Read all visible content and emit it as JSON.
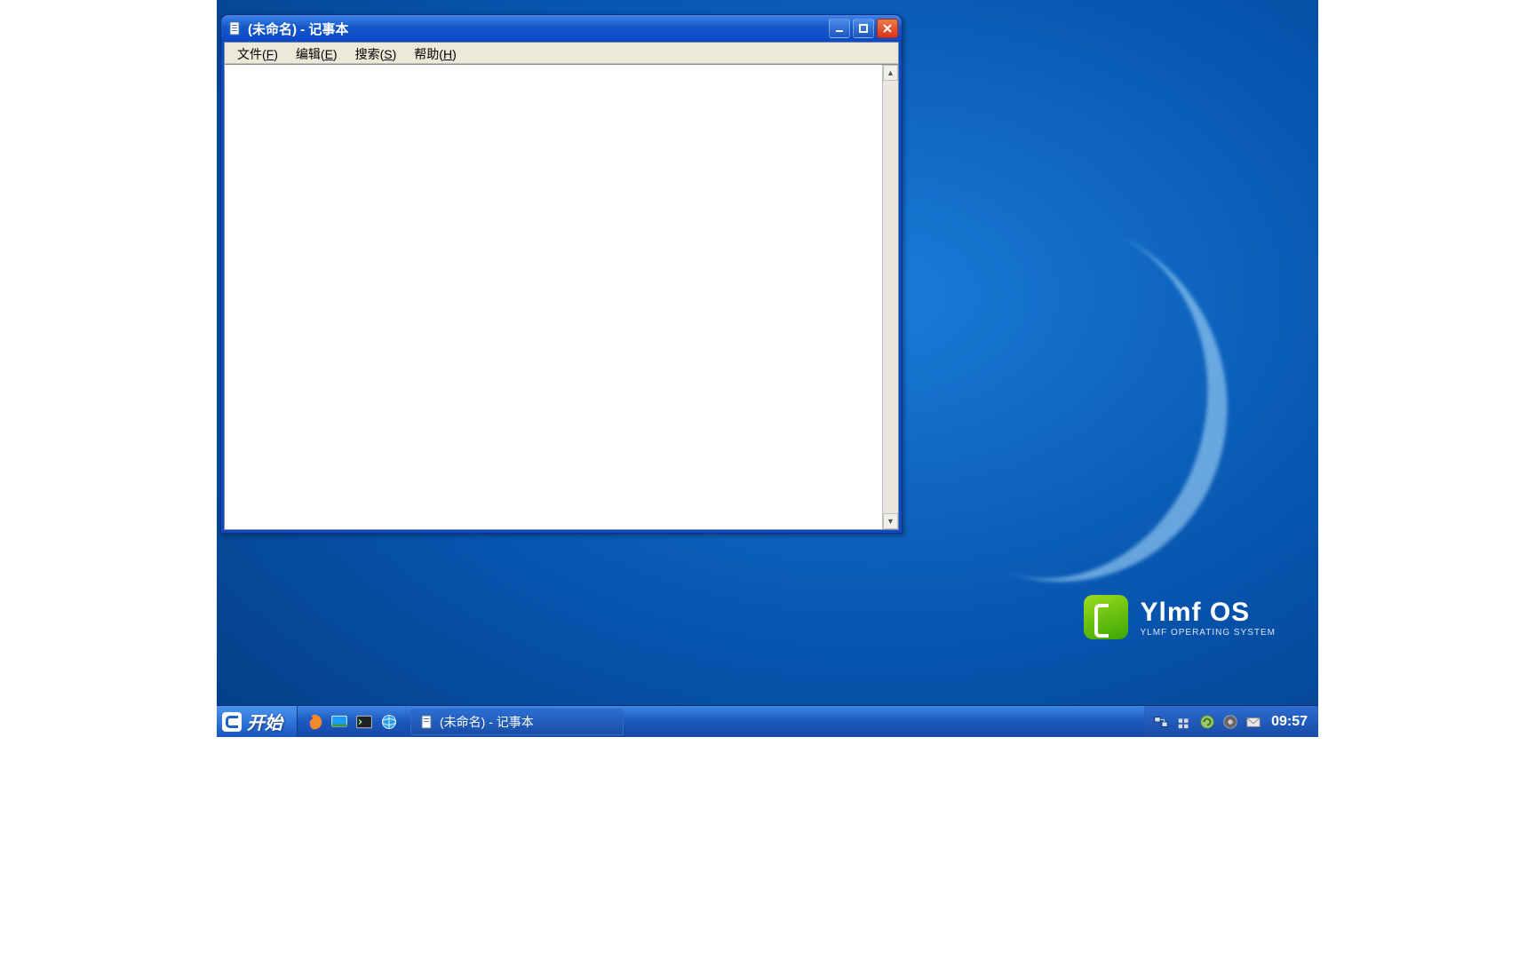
{
  "window": {
    "title": "(未命名) - 记事本",
    "menubar": {
      "file": {
        "label": "文件",
        "accel": "F"
      },
      "edit": {
        "label": "编辑",
        "accel": "E"
      },
      "search": {
        "label": "搜索",
        "accel": "S"
      },
      "help": {
        "label": "帮助",
        "accel": "H"
      }
    },
    "editor_content": ""
  },
  "branding": {
    "name": "Ylmf OS",
    "tagline": "YLMF OPERATING SYSTEM"
  },
  "taskbar": {
    "start_label": "开始",
    "active_task_label": "(未命名) - 记事本",
    "clock": "09:57"
  },
  "glyph": {
    "up": "▲",
    "down": "▼"
  }
}
